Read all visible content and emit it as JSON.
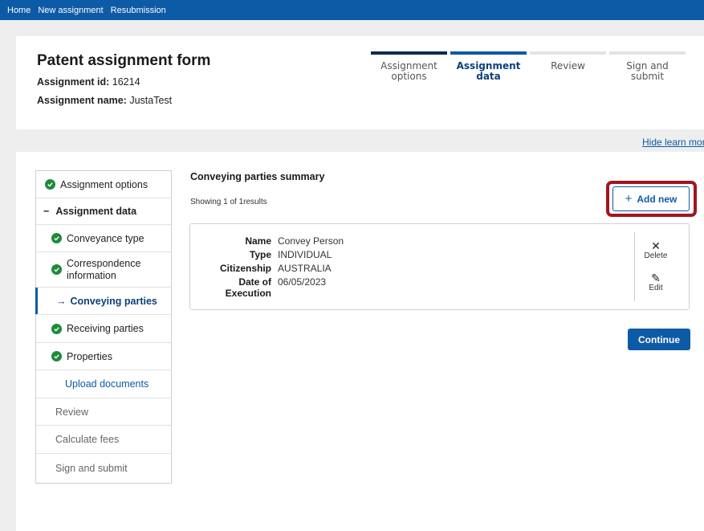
{
  "topnav": [
    "Home",
    "New assignment",
    "Resubmission"
  ],
  "header": {
    "title": "Patent assignment form",
    "id_label": "Assignment id:",
    "id_value": "16214",
    "name_label": "Assignment name:",
    "name_value": "JustaTest"
  },
  "steps": [
    {
      "label": "Assignment options",
      "state": "done"
    },
    {
      "label": "Assignment data",
      "state": "active"
    },
    {
      "label": "Review",
      "state": "todo"
    },
    {
      "label": "Sign and submit",
      "state": "todo"
    }
  ],
  "learn_toggle": "Hide learn mor",
  "sidenav": {
    "items": [
      {
        "label": "Assignment options",
        "kind": "done"
      },
      {
        "label": "Assignment data",
        "kind": "group"
      },
      {
        "label": "Conveyance type",
        "kind": "done"
      },
      {
        "label": "Correspondence information",
        "kind": "done"
      },
      {
        "label": "Conveying parties",
        "kind": "current"
      },
      {
        "label": "Receiving parties",
        "kind": "done"
      },
      {
        "label": "Properties",
        "kind": "done"
      },
      {
        "label": "Upload documents",
        "kind": "link"
      },
      {
        "label": "Review",
        "kind": "muted"
      },
      {
        "label": "Calculate fees",
        "kind": "muted"
      },
      {
        "label": "Sign and submit",
        "kind": "muted"
      }
    ]
  },
  "summary": {
    "title": "Conveying parties summary",
    "showing": "Showing 1 of 1results",
    "add_new": "Add new",
    "party": {
      "name_label": "Name",
      "name_value": "Convey Person",
      "type_label": "Type",
      "type_value": "INDIVIDUAL",
      "citizenship_label": "Citizenship",
      "citizenship_value": "AUSTRALIA",
      "doe_label": "Date of Execution",
      "doe_value": "06/05/2023"
    },
    "delete_label": "Delete",
    "edit_label": "Edit",
    "continue_label": "Continue"
  },
  "colors": {
    "brand": "#0d5aa7",
    "complete": "#1f8a3b",
    "highlight": "#a4141f"
  }
}
